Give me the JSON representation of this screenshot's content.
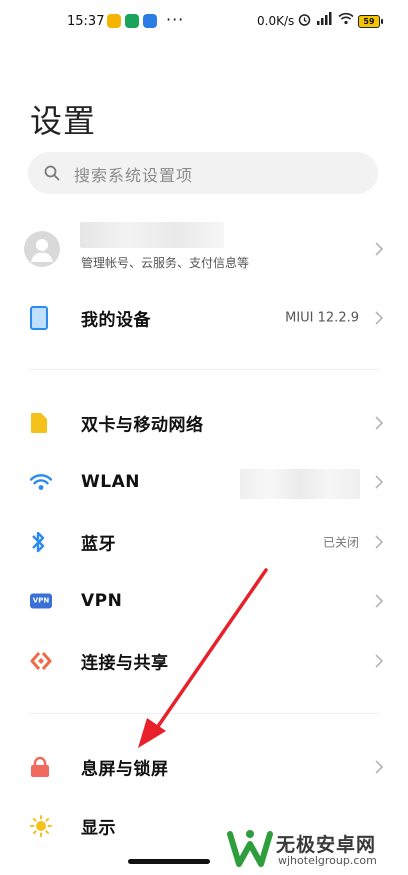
{
  "status_bar": {
    "time": "15:37",
    "dots": "···",
    "net_speed": "0.0K/s",
    "battery": "59"
  },
  "title": "设置",
  "search": {
    "placeholder": "搜索系统设置项"
  },
  "account": {
    "subtitle": "管理帐号、云服务、支付信息等"
  },
  "device": {
    "label": "我的设备",
    "value": "MIUI 12.2.9"
  },
  "rows": [
    {
      "label": "双卡与移动网络",
      "icon": "sim-card-icon"
    },
    {
      "label": "WLAN",
      "icon": "wifi-icon"
    },
    {
      "label": "蓝牙",
      "value": "已关闭",
      "icon": "bluetooth-icon"
    },
    {
      "label": "VPN",
      "icon": "vpn-icon",
      "icon_text": "VPN"
    },
    {
      "label": "连接与共享",
      "icon": "connection-sharing-icon"
    },
    {
      "label": "息屏与锁屏",
      "icon": "lock-icon"
    },
    {
      "label": "显示",
      "icon": "sun-icon"
    }
  ],
  "watermark": {
    "title": "无极安卓网",
    "url": "wjhotelgroup.com"
  },
  "colors": {
    "accent_blue": "#2b8bf2",
    "sim_yellow": "#f5c21b",
    "lock_red": "#f06b5b",
    "vpn_blue": "#3a6fd8",
    "annotation_red": "#e8202a",
    "watermark_green": "#2e9e3c"
  }
}
